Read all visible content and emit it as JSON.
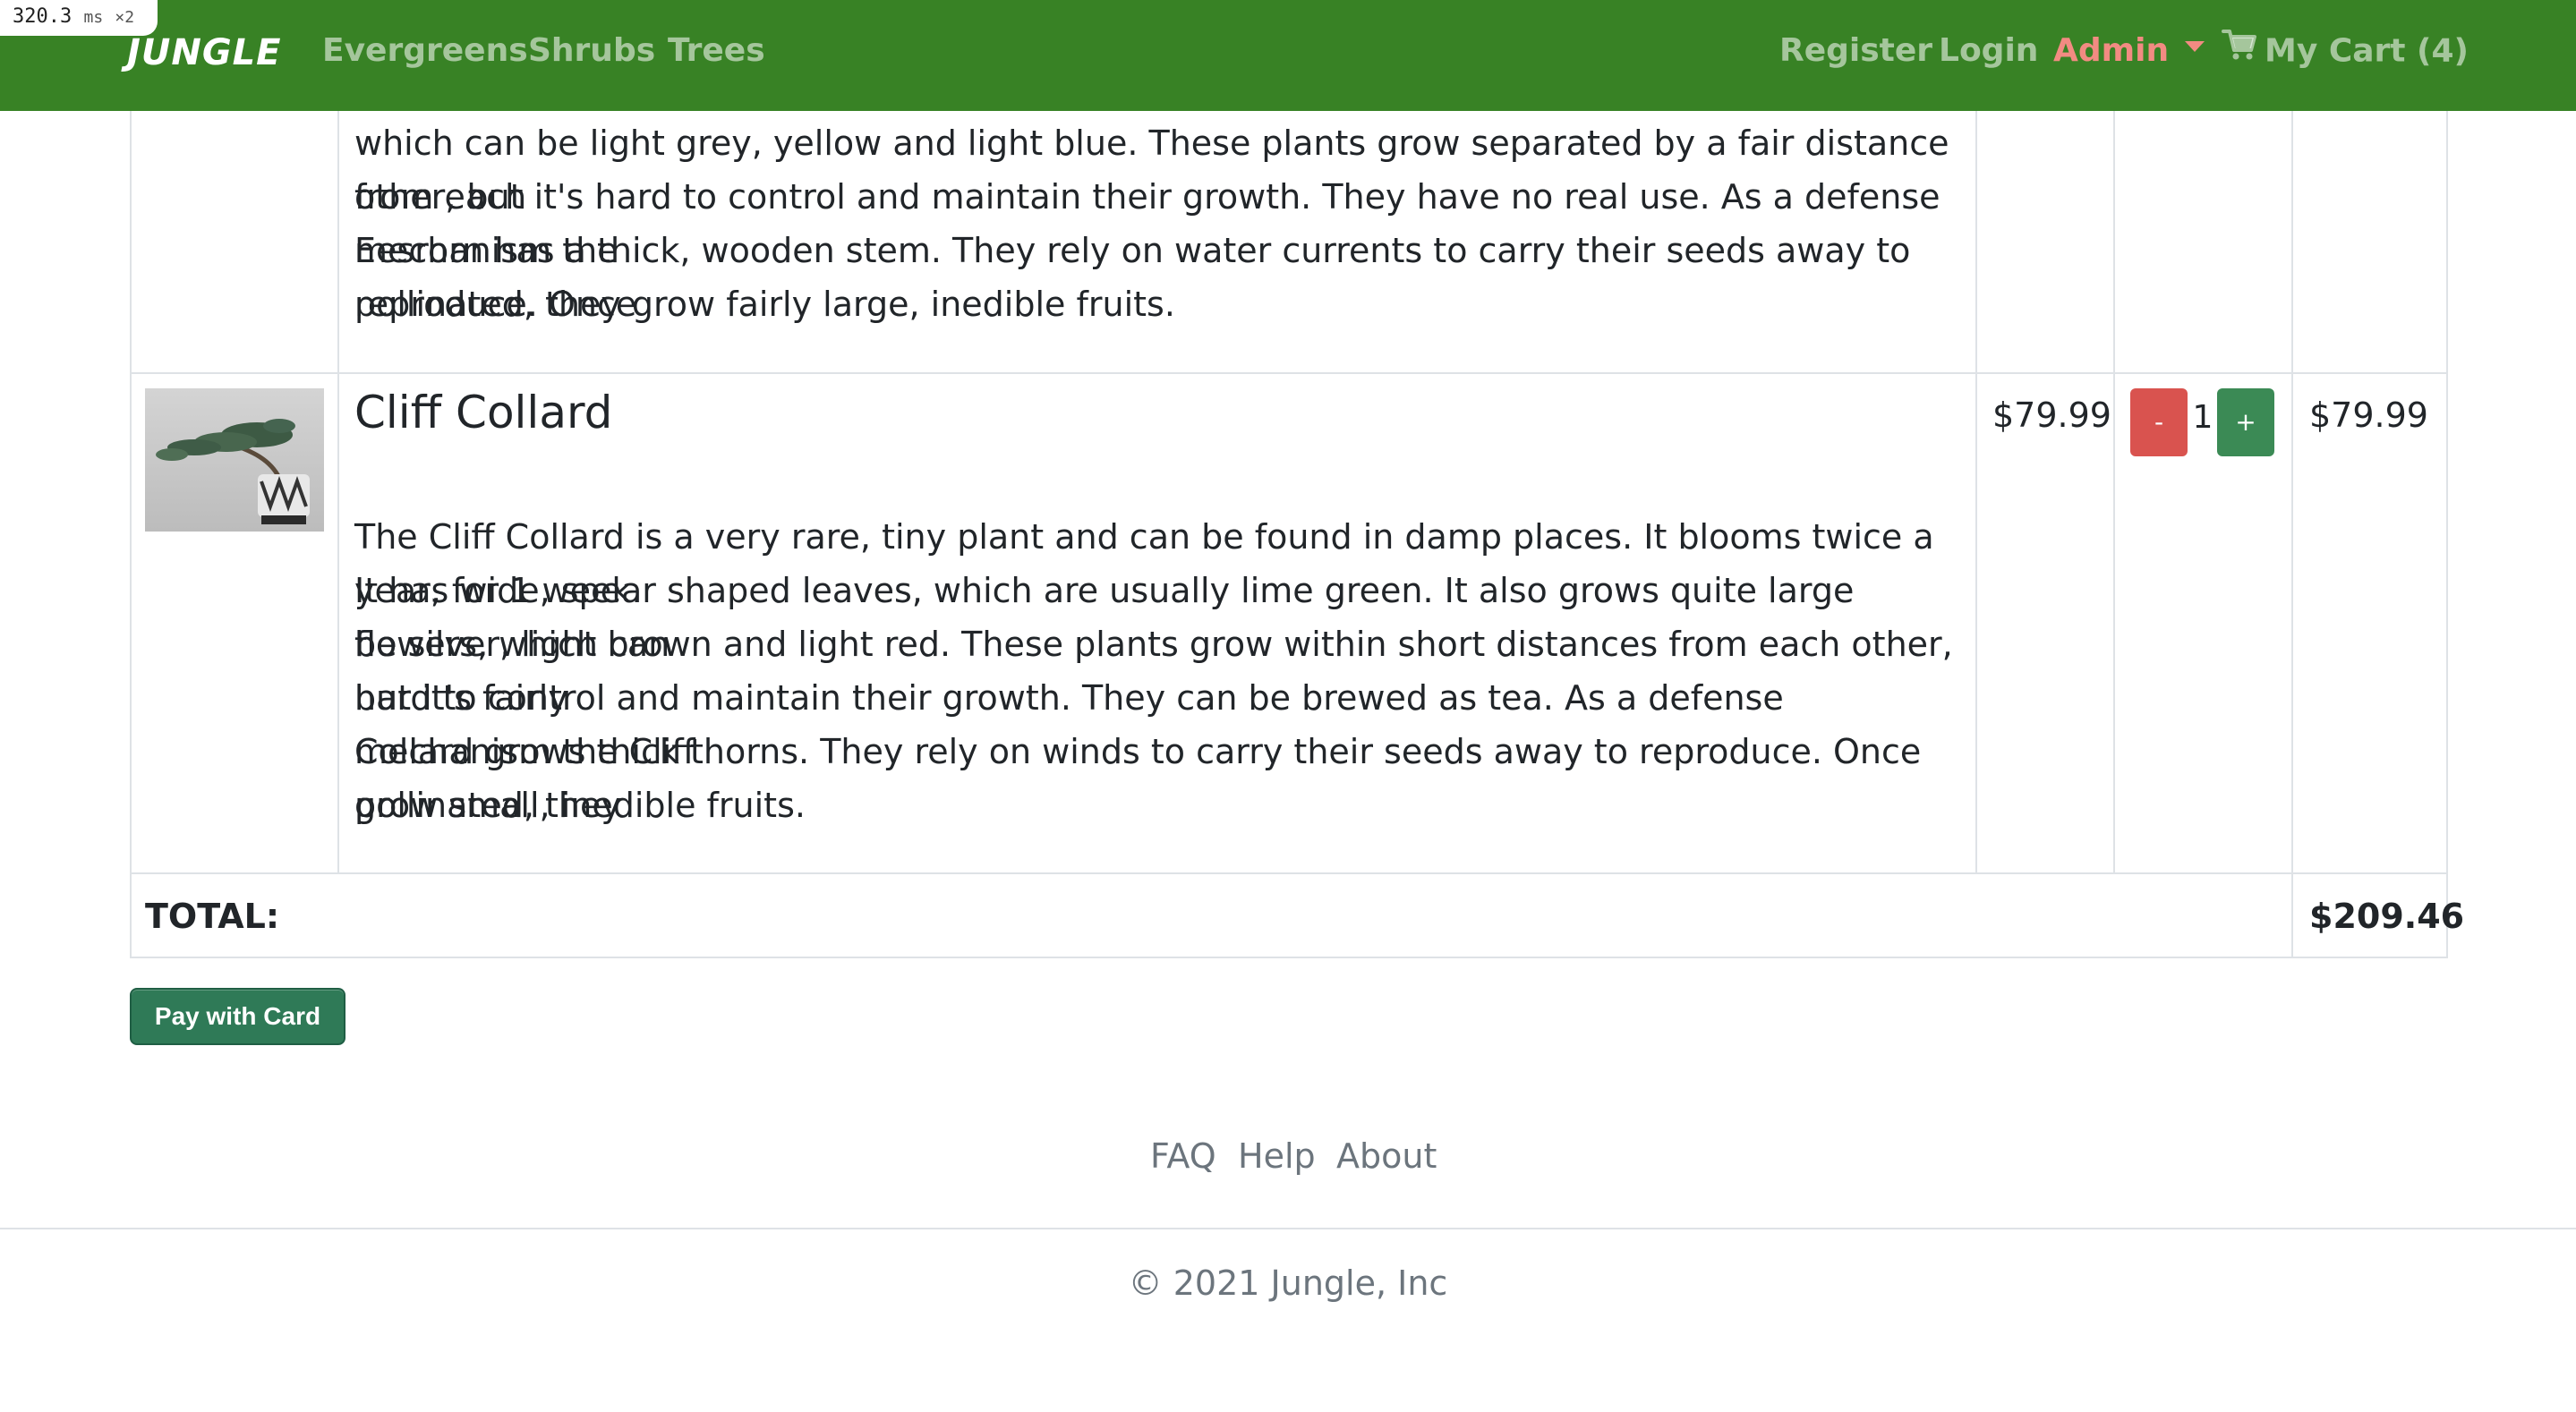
{
  "perf_badge": {
    "value": "320.3",
    "unit": "ms",
    "multiplier": "×2"
  },
  "navbar": {
    "brand": "JUNGLE",
    "links": [
      "Evergreens",
      "Shrubs",
      "Trees"
    ],
    "register": "Register",
    "login": "Login",
    "admin": "Admin",
    "cart": "My Cart (4)"
  },
  "cart": {
    "previous_item": {
      "description_lines": [
        "which can be light grey, yellow and light blue. These plants grow separated by a fair distance from each",
        "other, but it's hard to control and maintain their growth. They have no real use. As a defense mechanism the",
        "Eesrorn has a thick, wooden stem. They rely on water currents to carry their seeds away to reproduce. Once",
        "pollinated, they grow fairly large, inedible fruits."
      ]
    },
    "item": {
      "name": "Cliff Collard",
      "image_alt": "bonsai tree in patterned pot",
      "description_lines": [
        "The Cliff Collard is a very rare, tiny plant and can be found in damp places. It blooms twice a year, for 1 week.",
        "It has wide, spear shaped leaves, which are usually lime green. It also grows quite large flowers, which can",
        "be silver, light brown and light red. These plants grow within short distances from each other, but it's fairly",
        "hard to control and maintain their growth. They can be brewed as tea. As a defense mechanism the Cliff",
        "Collard grows thick thorns. They rely on winds to carry their seeds away to reproduce. Once pollinated, they",
        "grow small, inedible fruits."
      ],
      "price": "$79.99",
      "minus_label": "-",
      "quantity": "1",
      "plus_label": "+",
      "line_total": "$79.99"
    },
    "total_label": "TOTAL:",
    "total_value": "$209.46",
    "pay_button": "Pay with Card"
  },
  "footer": {
    "links": [
      "FAQ",
      "Help",
      "About"
    ],
    "copyright": "© 2021 Jungle, Inc"
  },
  "colors": {
    "navbar_bg": "#388225",
    "admin_link": "#f28b82",
    "minus_button": "#d9534f",
    "plus_button": "#3b8a55",
    "pay_button": "#2f7a57"
  },
  "icons": [
    "cart-icon",
    "caret-down-icon",
    "product-thumbnail"
  ]
}
